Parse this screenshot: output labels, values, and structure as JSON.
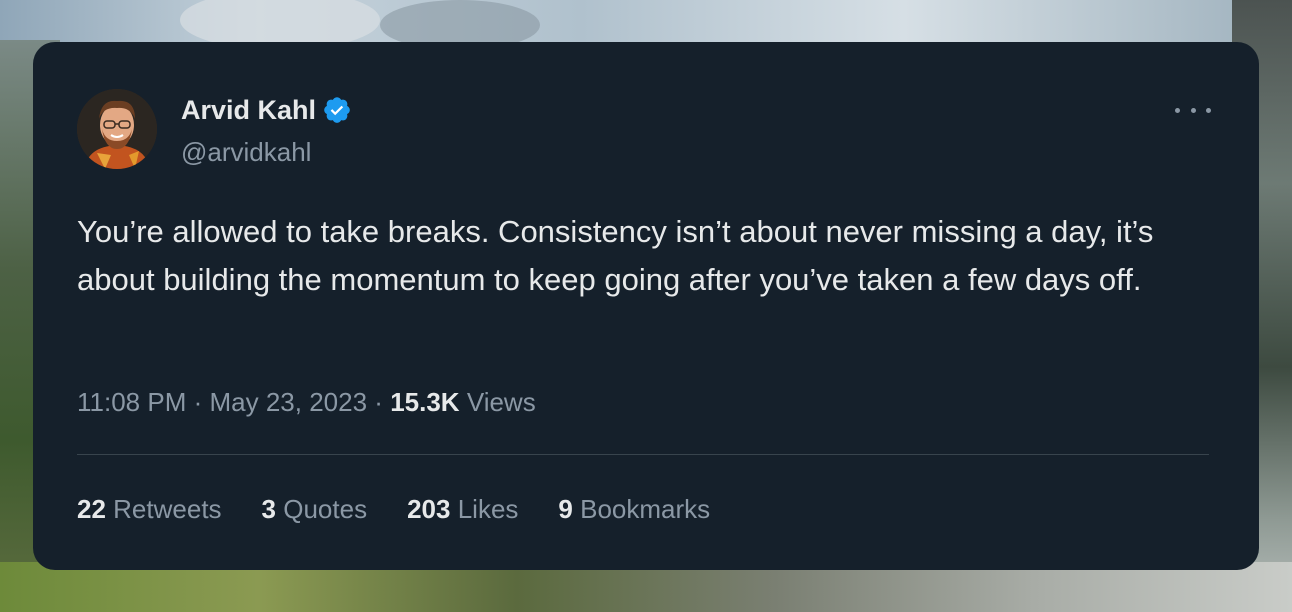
{
  "tweet": {
    "author": {
      "name": "Arvid Kahl",
      "handle": "@arvidkahl",
      "verified": true
    },
    "text": "You’re allowed to take breaks. Consistency isn’t about never missing a day, it’s about building the momentum to keep going after you’ve taken a few days off.",
    "time": "11:08 PM",
    "date": "May 23, 2023",
    "separator": "·",
    "views_count": "15.3K",
    "views_label": "Views",
    "stats": [
      {
        "count": "22",
        "label": "Retweets"
      },
      {
        "count": "3",
        "label": "Quotes"
      },
      {
        "count": "203",
        "label": "Likes"
      },
      {
        "count": "9",
        "label": "Bookmarks"
      }
    ]
  },
  "icons": {
    "verified": "verified-badge-icon",
    "more": "more-horizontal-icon"
  },
  "colors": {
    "card_background": "#15202b",
    "primary_text": "#e7e9ea",
    "secondary_text": "#8b98a5",
    "verified_blue": "#1d9bf0",
    "divider": "#38444d"
  }
}
